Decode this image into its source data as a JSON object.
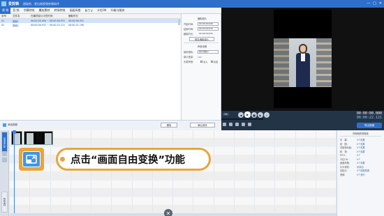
{
  "titlebar": {
    "app_name": "爱剪辑",
    "subtitle": "超级剪、更出格视频剪辑软件",
    "controls": [
      "—",
      "□",
      "✕"
    ]
  },
  "tabs": [
    {
      "label": "视 频",
      "active": true
    },
    {
      "label": "音 频",
      "active": false
    },
    {
      "label": "字幕特效",
      "active": false
    },
    {
      "label": "叠加素材",
      "active": false
    },
    {
      "label": "转场特效",
      "active": false
    },
    {
      "label": "画面风格",
      "active": false
    },
    {
      "label": "M T V",
      "active": false
    },
    {
      "label": "卡拉OK",
      "active": false
    },
    {
      "label": "升级与服务",
      "active": false
    }
  ],
  "list": {
    "columns": [
      "序号",
      "文件名",
      "在最终影片中的时间",
      "截取时长",
      ""
    ],
    "rows": [
      {
        "num": "01",
        "name": "视频1",
        "final_time": "00:00:00.000 ~ 00:00:00.931",
        "duration": "00:00:00.931",
        "selected": true
      },
      {
        "num": "02",
        "name": "视频2",
        "final_time": "00:00:00.931 ~ 00:00:22.121",
        "duration": "00:00:21.190",
        "selected": false
      }
    ]
  },
  "settings": {
    "clip_header": "截取原片",
    "start_label": "开始时间:",
    "start_value": "00:00:00.000",
    "end_label": "结束时间:",
    "end_value": "00:00:00.931",
    "dur_label": "截取时长:",
    "dur_value": "00:00:00.931",
    "preview_btn": "预览/截取原片",
    "audio_header": "声音设置",
    "track_label": "使用音轨:",
    "track_value": "原片音轨1",
    "volume_label": "原片音量:",
    "volume_value": "100",
    "fade_label": "头尾声音:",
    "fade_in": "淡入",
    "fade_out": "淡出"
  },
  "listbar": {
    "add_label": "添加视频",
    "delete_label": "删除",
    "confirm_label": "确认修改"
  },
  "player": {
    "speed": "1X",
    "current_time": "00:00:00.000",
    "total_time": "00:00:22.121",
    "export_label": "导出视频"
  },
  "timeline": {
    "side_tabs": [
      "已添加片段",
      "所有素材"
    ],
    "track_label": "双击此处添加视频"
  },
  "callout": {
    "text": "点击“画面自由变换”功能"
  },
  "fxpanel": {
    "header": "所有制作的特效",
    "rows": [
      {
        "k": "字　幕:",
        "v": "0个效果"
      },
      {
        "k": "贴　图:",
        "v": "0个效果"
      },
      {
        "k": "关键帧动画:",
        "v": "0个效果"
      },
      {
        "k": "转　场:",
        "v": "0个效果"
      },
      {
        "k": "MTV:",
        "v": "0个"
      },
      {
        "k": "卡拉OK:",
        "v": "0个"
      },
      {
        "k": "画面风格:",
        "v": "0个效果"
      },
      {
        "k": "片头特效:",
        "v": "未添加"
      },
      {
        "k": "加贴片:",
        "v": "0个贴图效果"
      },
      {
        "k": "音频:",
        "v": "0个音乐"
      }
    ]
  },
  "colors": {
    "accent": "#2f6fc9",
    "callout": "#e8a53a"
  }
}
